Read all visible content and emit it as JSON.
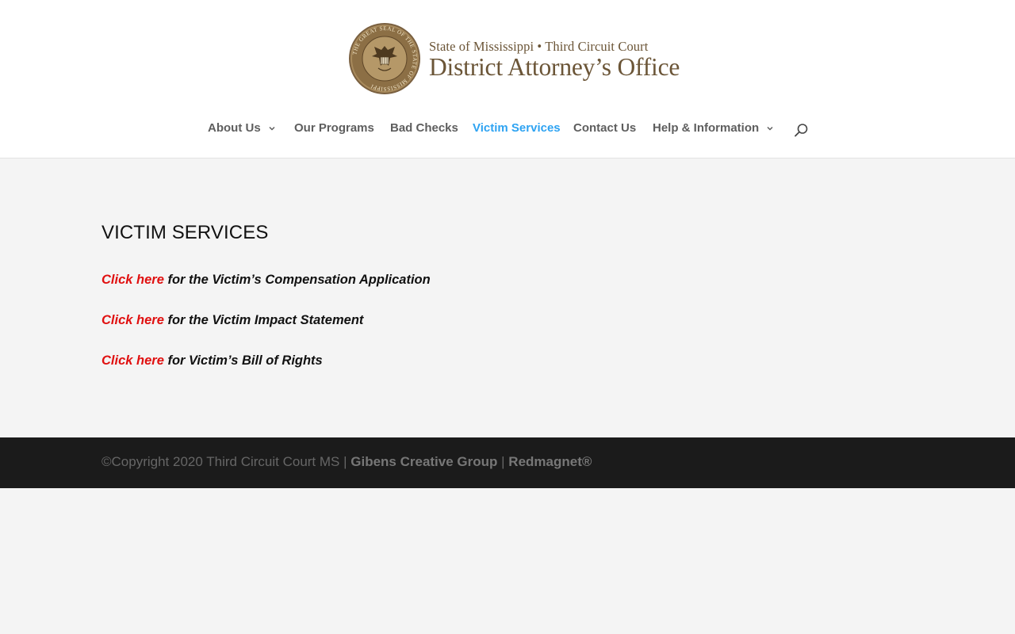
{
  "header": {
    "logo": {
      "line1": "State of Mississippi • Third Circuit Court",
      "line2": "District Attorney’s Office",
      "seal_icon": "state-seal-icon",
      "seal_text": "THE GREAT SEAL OF THE STATE OF MISSISSIPPI",
      "brand_color": "#6b5537"
    }
  },
  "nav": {
    "items": [
      {
        "label": "About Us",
        "has_dropdown": true
      },
      {
        "label": "Our Programs",
        "has_dropdown": false
      },
      {
        "label": "Bad Checks",
        "has_dropdown": false
      },
      {
        "label": "Victim Services",
        "has_dropdown": false,
        "active": true
      },
      {
        "label": "Contact Us",
        "has_dropdown": false
      },
      {
        "label": "Help & Information",
        "has_dropdown": true
      }
    ],
    "search_icon": "search-icon",
    "active_color": "#2ea3f2",
    "text_color": "#5e5e5e"
  },
  "main": {
    "title": "VICTIM SERVICES",
    "links": [
      {
        "link_text": "Click here",
        "description": " for the Victim’s Compensation Application"
      },
      {
        "link_text": "Click here",
        "description": " for the Victim Impact Statement"
      },
      {
        "link_text": "Click here",
        "description": " for Victim’s Bill of Rights"
      }
    ],
    "link_color": "#e01010"
  },
  "footer": {
    "copyright": "©Copyright 2020 Third Circuit Court MS | ",
    "link1": "Gibens Creative Group",
    "separator": " | ",
    "link2": "Redmagnet®",
    "background": "#1b1b1b"
  }
}
